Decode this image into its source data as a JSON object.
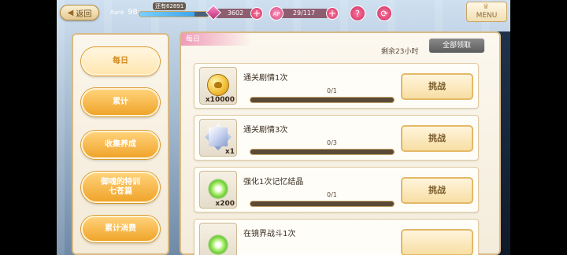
{
  "topbar": {
    "back_label": "返回",
    "rank_label": "Rank",
    "rank_level": "98",
    "rank_remaining": "还有62891",
    "rank_progress": 0.8,
    "gems": "3602",
    "ap_label": "AP",
    "ap_value": "29/117",
    "help_icon": "?",
    "menu_label": "MENU"
  },
  "sidebar": {
    "items": [
      {
        "label": "每日"
      },
      {
        "label": "累计"
      },
      {
        "label": "收集养成"
      },
      {
        "label": "御魂的特训\n七苍篇"
      },
      {
        "label": "累计消费"
      }
    ]
  },
  "panel": {
    "tab_label": "每日",
    "remaining": "剩余23小时",
    "claim_all": "全部领取",
    "tasks": [
      {
        "title": "通关剧情1次",
        "progress": "0/1",
        "qty": "x10000",
        "button": "挑战",
        "fill": 0
      },
      {
        "title": "通关剧情3次",
        "progress": "0/3",
        "qty": "x1",
        "button": "挑战",
        "fill": 0
      },
      {
        "title": "强化1次记忆结晶",
        "progress": "0/1",
        "qty": "x200",
        "button": "挑战",
        "fill": 0
      },
      {
        "title": "在镜界战斗1次",
        "progress": "",
        "qty": "",
        "button": "",
        "fill": 0
      }
    ]
  },
  "colors": {
    "accent_gold": "#e3b967",
    "accent_pink": "#f09bb8"
  }
}
